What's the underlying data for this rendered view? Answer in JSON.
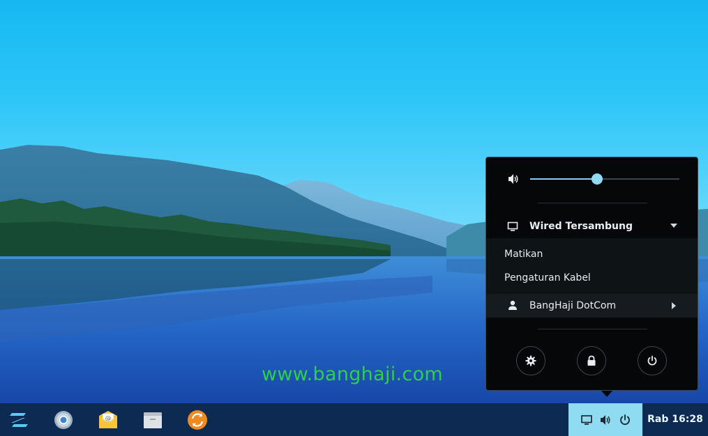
{
  "desktop": {
    "watermark": "www.banghaji.com"
  },
  "taskbar": {
    "apps": [
      {
        "name": "zorin-menu-icon"
      },
      {
        "name": "chromium-icon"
      },
      {
        "name": "mail-icon"
      },
      {
        "name": "files-icon"
      },
      {
        "name": "software-updater-icon"
      }
    ],
    "tray": [
      "network-wired-icon",
      "volume-icon",
      "power-icon"
    ],
    "clock": "Rab 16:28"
  },
  "system_menu": {
    "volume_level": 0.45,
    "network": {
      "label": "Wired Tersambung",
      "items": [
        "Matikan",
        "Pengaturan Kabel"
      ]
    },
    "user": {
      "name": "BangHaji DotCom"
    },
    "actions": [
      "settings-icon",
      "lock-icon",
      "power-icon"
    ],
    "accent": "#8fd9f5"
  }
}
